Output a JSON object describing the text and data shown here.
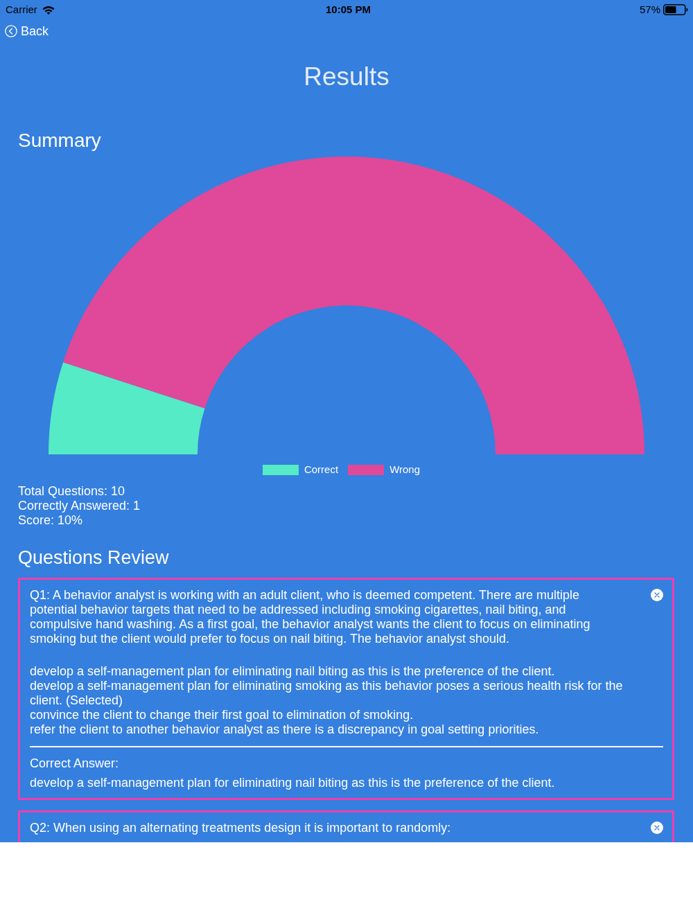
{
  "status_bar": {
    "carrier": "Carrier",
    "time": "10:05 PM",
    "battery": "57%"
  },
  "nav": {
    "back": "Back"
  },
  "title": "Results",
  "summary": {
    "heading": "Summary",
    "chart_data": {
      "type": "donut",
      "categories": [
        "Correct",
        "Wrong"
      ],
      "values": [
        10,
        90
      ],
      "legend": "bottom"
    },
    "slices": [
      {
        "color": "#55ebc6"
      },
      {
        "color": "#e0489a"
      }
    ],
    "stats": [
      "Total Questions: 10",
      "Correctly Answered: 1",
      "Score: 10%"
    ]
  },
  "review": {
    "heading": "Questions Review",
    "questions": [
      {
        "question": "Q1: A behavior analyst is working with an adult client, who is deemed competent. There are multiple potential behavior targets that need to be addressed including smoking cigarettes, nail biting, and compulsive hand washing. As a first goal, the behavior analyst wants the client to focus on eliminating smoking but the client would prefer to focus on nail biting. The behavior analyst should.",
        "correct": false,
        "options": [
          "develop a self-management plan for eliminating nail biting as this is the preference of the client.",
          "develop a self-management plan for eliminating smoking as this behavior poses a serious health risk for the client. (Selected)",
          "convince the client to change their first goal to elimination of smoking.",
          "refer the client to another behavior analyst as there is a discrepancy in goal setting priorities."
        ],
        "answer_label": "Correct Answer:",
        "answer": "develop a self-management plan for eliminating nail biting as this is the preference of the client."
      },
      {
        "question": "Q2: When using an alternating treatments design it is important to randomly:",
        "correct": false
      }
    ]
  }
}
